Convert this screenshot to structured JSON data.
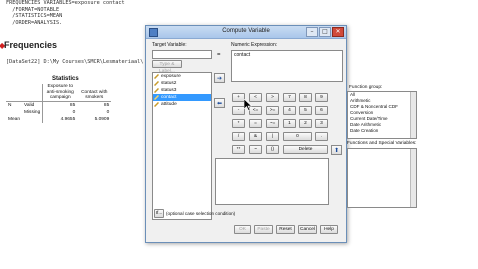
{
  "output": {
    "syntax_lines": [
      "FREQUENCIES VARIABLES=exposure contact",
      "  /FORMAT=NOTABLE",
      "  /STATISTICS=MEAN",
      "  /ORDER=ANALYSIS."
    ],
    "heading": "Frequencies",
    "dataset": "[DataSet22] D:\\My Courses\\SMCR\\Lesmateriaal\\",
    "stats_title": "Statistics",
    "col1_header": "Exposure to anti-smoking campaign",
    "col2_header": "Contact with smokers",
    "rows": [
      {
        "h1": "N",
        "h2": "Valid",
        "v1": "85",
        "v2": "85"
      },
      {
        "h1": "",
        "h2": "Missing",
        "v1": "0",
        "v2": "0"
      },
      {
        "h1": "Mean",
        "h2": "",
        "v1": "4.9655",
        "v2": "5.0909"
      }
    ]
  },
  "dialog": {
    "title": "Compute Variable",
    "target_variable_label": "Target Variable:",
    "type_label_button": "Type & Label...",
    "equals": "=",
    "numeric_expression_label": "Numeric Expression:",
    "numeric_expression_value": "contact",
    "variables": [
      "exposure",
      "status2",
      "status3",
      "contact",
      "attitude"
    ],
    "selected_variable": "contact",
    "keypad": [
      [
        "+",
        "<",
        ">",
        "7",
        "8",
        "9"
      ],
      [
        "-",
        "<=",
        ">=",
        "4",
        "5",
        "6"
      ],
      [
        "*",
        "=",
        "~=",
        "1",
        "2",
        "3"
      ],
      [
        "/",
        "&",
        "|",
        "0",
        "."
      ],
      [
        "**",
        "~",
        "()",
        "Delete"
      ]
    ],
    "function_group_label": "Function group:",
    "function_groups": [
      "All",
      "Arithmetic",
      "CDF & Noncentral CDF",
      "Conversion",
      "Current Date/Time",
      "Date Arithmetic",
      "Date Creation"
    ],
    "functions_label": "Functions and Special Variables:",
    "if_button": "If...",
    "if_caption": "(optional case selection condition)",
    "buttons": {
      "ok": "OK",
      "paste": "Paste",
      "reset": "Reset",
      "cancel": "Cancel",
      "help": "Help"
    }
  }
}
